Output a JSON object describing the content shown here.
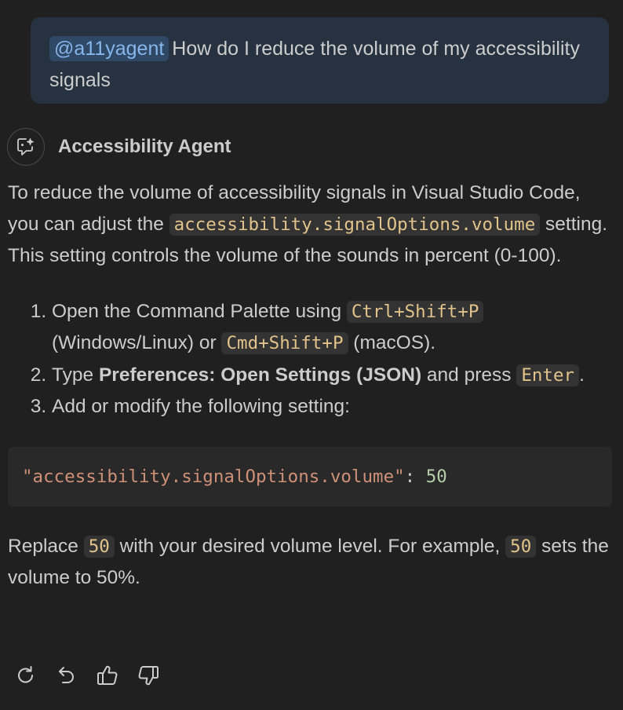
{
  "request": {
    "mention": "@a11yagent",
    "text": "How do I reduce the volume of my accessibility signals"
  },
  "agent": {
    "avatar_icon": "chat-sparkle-icon",
    "name": "Accessibility Agent"
  },
  "response": {
    "intro_1": "To reduce the volume of accessibility signals in Visual Studio Code, you can adjust the ",
    "intro_code": "accessibility.signalOptions.volume",
    "intro_2": " setting. This setting controls the volume of the sounds in percent (0-100).",
    "steps": [
      {
        "t1": "Open the Command Palette using ",
        "c1": "Ctrl+Shift+P",
        "t2": " (Windows/Linux) or ",
        "c2": "Cmd+Shift+P",
        "t3": " (macOS)."
      },
      {
        "t1": "Type ",
        "bold": "Preferences: Open Settings (JSON)",
        "t2": " and press ",
        "c1": "Enter",
        "t3": "."
      },
      {
        "t1": "Add or modify the following setting:"
      }
    ],
    "code_block": {
      "key": "\"accessibility.signalOptions.volume\"",
      "colon": ": ",
      "value": "50"
    },
    "closing": {
      "t1": "Replace ",
      "c1": "50",
      "t2": " with your desired volume level. For example, ",
      "c2": "50",
      "t3": " sets the volume to 50%."
    }
  },
  "actions": [
    {
      "icon": "retry-icon"
    },
    {
      "icon": "undo-icon"
    },
    {
      "icon": "thumbs-up-icon"
    },
    {
      "icon": "thumbs-down-icon"
    }
  ],
  "colors": {
    "background": "#202020",
    "request_bubble": "#263240",
    "mention_bg": "#2e4866",
    "mention_text": "#86b6ec",
    "inline_code_bg": "#333333",
    "inline_code_text": "#e1c38b",
    "code_block_bg": "#292929",
    "string_token": "#ce9178",
    "number_token": "#b5cea8"
  }
}
